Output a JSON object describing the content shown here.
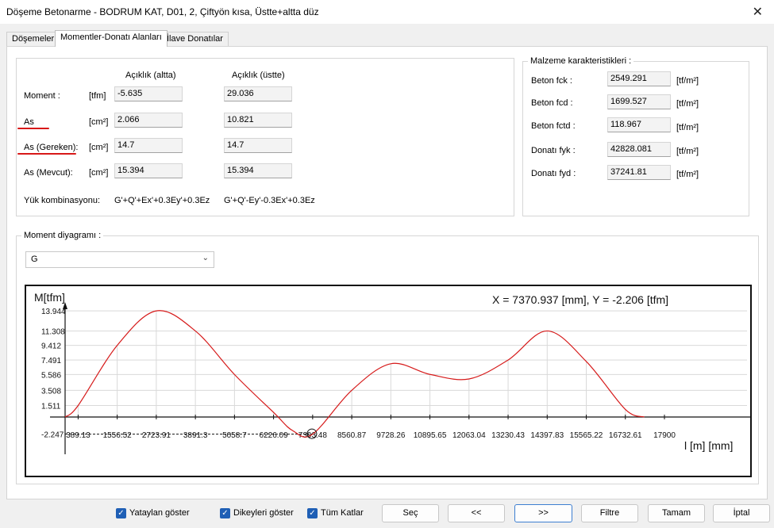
{
  "window": {
    "title": "Döşeme Betonarme - BODRUM KAT, D01, 2, Çiftyön kısa, Üstte+altta düz",
    "close_glyph": "✕"
  },
  "tabs": [
    "Döşemeler",
    "Momentler-Donatı Alanları",
    "İlave Donatılar"
  ],
  "momentler": {
    "col_headers": [
      "Açıklık (altta)",
      "Açıklık (üstte)"
    ],
    "rows": [
      {
        "label": "Moment :",
        "unit": "[tfm]",
        "altta": "-5.635",
        "ustte": "29.036"
      },
      {
        "label": "As",
        "unit": "[cm²]",
        "altta": "2.066",
        "ustte": "10.821"
      },
      {
        "label": "As (Gereken):",
        "unit": "[cm²]",
        "altta": "14.7",
        "ustte": "14.7"
      },
      {
        "label": "As (Mevcut):",
        "unit": "[cm²]",
        "altta": "15.394",
        "ustte": "15.394"
      }
    ],
    "yuk_label": "Yük kombinasyonu:",
    "yuk_altta": "G'+Q'+Ex'+0.3Ey'+0.3Ez",
    "yuk_ustte": "G'+Q'-Ey'-0.3Ex'+0.3Ez",
    "highlight_color": "#d81818"
  },
  "malzeme": {
    "title": "Malzeme karakteristikleri :",
    "items": [
      {
        "label": "Beton fck :",
        "value": "2549.291",
        "unit": "[tf/m²]"
      },
      {
        "label": "Beton fcd :",
        "value": "1699.527",
        "unit": "[tf/m²]"
      },
      {
        "label": "Beton fctd :",
        "value": "118.967",
        "unit": "[tf/m²]"
      },
      {
        "label": "Donatı fyk :",
        "value": "42828.081",
        "unit": "[tf/m²]"
      },
      {
        "label": "Donatı fyd :",
        "value": "37241.81",
        "unit": "[tf/m²]"
      }
    ]
  },
  "diagram": {
    "title": "Moment diyagramı :",
    "selected": "G",
    "readout": "X = 7370.937 [mm],  Y = -2.206 [tfm]",
    "curve_color": "#d61a1a"
  },
  "chart_data": {
    "type": "line",
    "ylabel": "M[tfm]",
    "xlabel": "l [m] [mm]",
    "x_ticks": [
      "389.13",
      "1556.52",
      "2723.91",
      "3891.3",
      "5058.7",
      "6226.09",
      "7393.48",
      "8560.87",
      "9728.26",
      "10895.65",
      "12063.04",
      "13230.43",
      "14397.83",
      "15565.22",
      "16732.61",
      "17900"
    ],
    "y_ticks": [
      "13.944",
      "11.308",
      "9.412",
      "7.491",
      "5.586",
      "3.508",
      "1.511",
      "-2.247"
    ],
    "xlim": [
      0,
      17900
    ],
    "ylim": [
      -2.247,
      13.944
    ],
    "series": [
      {
        "x": [
          0,
          389.13,
          1556.52,
          2723.91,
          3891.3,
          5058.7,
          6226.09,
          6800,
          7393.48,
          8560.87,
          9728.26,
          10895.65,
          12063.04,
          13230.43,
          14397.83,
          15565.22,
          16732.61,
          17300
        ],
        "y": [
          0,
          1.511,
          9.412,
          13.944,
          11.308,
          5.586,
          0.6,
          -1.8,
          -2.247,
          3.508,
          7.0,
          5.6,
          5.0,
          7.491,
          11.308,
          7.3,
          1.0,
          0
        ]
      }
    ],
    "cursor": {
      "x": 7370.937,
      "y": -2.206
    }
  },
  "bottom": {
    "checkboxes": [
      "Yataylan göster",
      "Dikeyleri göster",
      "Tüm Katlar"
    ],
    "buttons": [
      "Seç",
      "<<",
      ">>",
      "Filtre",
      "Tamam",
      "İptal"
    ]
  }
}
